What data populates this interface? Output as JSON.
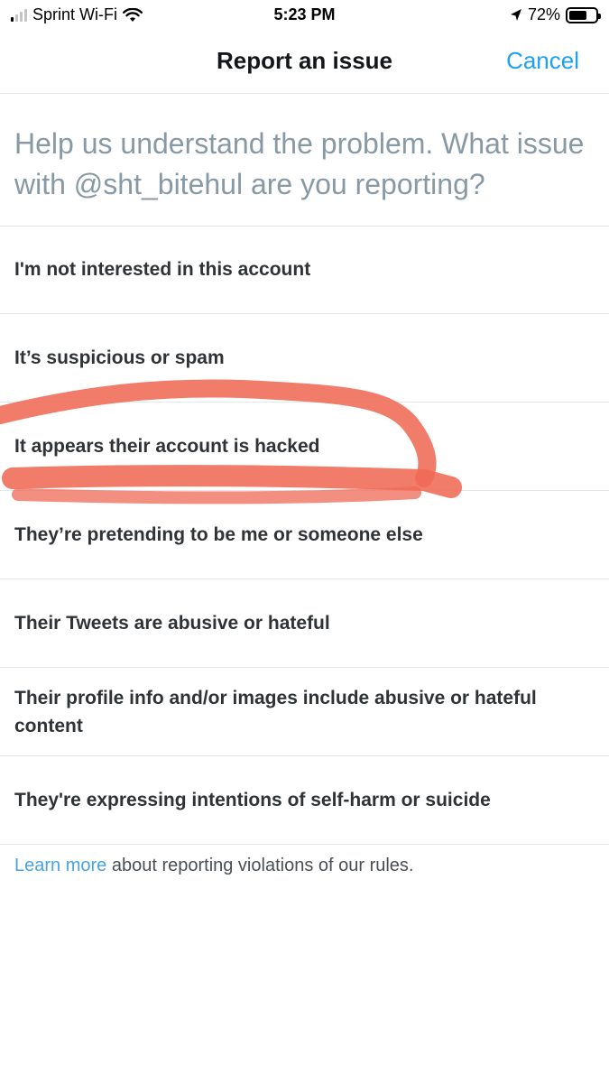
{
  "status_bar": {
    "carrier": "Sprint Wi-Fi",
    "time": "5:23 PM",
    "battery_percent": "72%",
    "battery_level": 0.72,
    "signal_bars_filled": 1,
    "signal_bars_total": 4,
    "icons": [
      "signal-icon",
      "wifi-icon",
      "location-icon",
      "battery-icon"
    ]
  },
  "nav": {
    "title": "Report an issue",
    "cancel_label": "Cancel"
  },
  "prompt": "Help us understand the problem. What issue with @sht_bitehul are you reporting?",
  "options": [
    {
      "label": "I'm not interested in this account"
    },
    {
      "label": "It’s suspicious or spam"
    },
    {
      "label": "It appears their account is hacked"
    },
    {
      "label": "They’re pretending to be me or someone else"
    },
    {
      "label": "Their Tweets are abusive or hateful"
    },
    {
      "label": "Their profile info and/or images include abusive or hateful content"
    },
    {
      "label": "They're expressing intentions of self-harm or suicide"
    }
  ],
  "footer": {
    "link_text": "Learn more",
    "text": " about reporting violations of our rules."
  },
  "colors": {
    "accent": "#1da1f2",
    "link": "#4aa3df",
    "prompt_gray": "#8899a6",
    "highlight_red": "#ef6a55"
  }
}
